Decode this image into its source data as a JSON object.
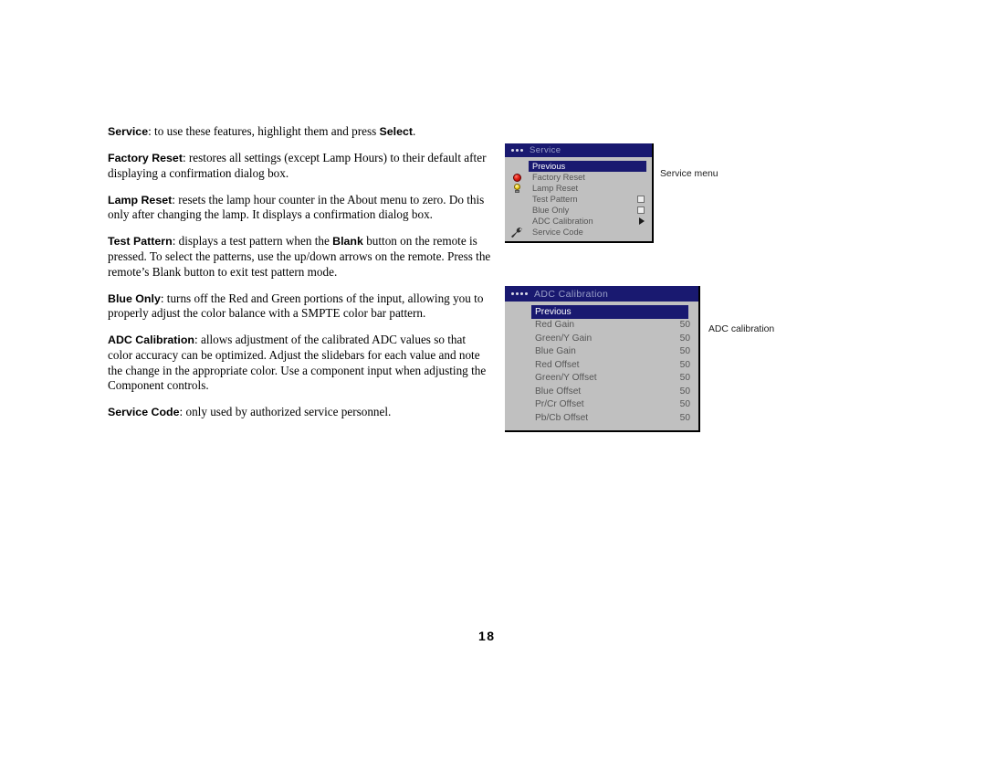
{
  "document": {
    "page_number": "18"
  },
  "body": {
    "paragraphs": [
      {
        "lead": "Service",
        "text_1": ": to use these features, highlight them and press ",
        "inline_bold": "Select",
        "text_2": "."
      },
      {
        "lead": "Factory Reset",
        "text_1": ": restores all settings (except Lamp Hours) to their default after displaying a confirmation dialog box.",
        "inline_bold": "",
        "text_2": ""
      },
      {
        "lead": "Lamp Reset",
        "text_1": ": resets the lamp hour counter in the About menu to zero. Do this only after changing the lamp. It displays a confirmation dialog box.",
        "inline_bold": "",
        "text_2": ""
      },
      {
        "lead": "Test Pattern",
        "text_1": ": displays a test pattern when the ",
        "inline_bold": "Blank",
        "text_2": " button on the remote is pressed. To select the patterns, use the up/down arrows on the remote. Press the remote’s Blank button to exit test pattern mode."
      },
      {
        "lead": "Blue Only",
        "text_1": ": turns off the Red and Green portions of the input, allowing you to properly adjust the color balance with a SMPTE color bar pattern.",
        "inline_bold": "",
        "text_2": ""
      },
      {
        "lead": "ADC Calibration",
        "text_1": ": allows adjustment of the calibrated ADC values so that color accuracy can be optimized. Adjust the slidebars for each value and note the change in the appropriate color. Use a component input when adjusting the Component controls.",
        "inline_bold": "",
        "text_2": ""
      },
      {
        "lead": "Service Code",
        "text_1": ": only used by authorized service personnel.",
        "inline_bold": "",
        "text_2": ""
      }
    ]
  },
  "service_menu": {
    "title": "Service",
    "title_dots": 3,
    "caption": "Service menu",
    "colors": {
      "title_bar": "#191970",
      "highlight": "#191970",
      "body": "#c0c0c0",
      "text": "#565656"
    },
    "items": [
      {
        "label": "Previous",
        "icon": "",
        "widget": "none",
        "selected": true
      },
      {
        "label": "Factory Reset",
        "icon": "reset-icon",
        "widget": "none",
        "selected": false
      },
      {
        "label": "Lamp Reset",
        "icon": "lamp-icon",
        "widget": "none",
        "selected": false
      },
      {
        "label": "Test Pattern",
        "icon": "",
        "widget": "checkbox",
        "selected": false
      },
      {
        "label": "Blue Only",
        "icon": "",
        "widget": "checkbox",
        "selected": false
      },
      {
        "label": "ADC Calibration",
        "icon": "",
        "widget": "arrow",
        "selected": false
      },
      {
        "label": "Service Code",
        "icon": "wrench-icon",
        "widget": "none",
        "selected": false
      }
    ]
  },
  "adc_menu": {
    "title": "ADC Calibration",
    "title_dots": 4,
    "caption": "ADC calibration",
    "colors": {
      "title_bar": "#191970",
      "highlight": "#191970",
      "body": "#c0c0c0",
      "text": "#565656"
    },
    "items": [
      {
        "label": "Previous",
        "value": "",
        "selected": true
      },
      {
        "label": "Red Gain",
        "value": "50",
        "selected": false
      },
      {
        "label": "Green/Y Gain",
        "value": "50",
        "selected": false
      },
      {
        "label": "Blue Gain",
        "value": "50",
        "selected": false
      },
      {
        "label": "Red Offset",
        "value": "50",
        "selected": false
      },
      {
        "label": "Green/Y Offset",
        "value": "50",
        "selected": false
      },
      {
        "label": "Blue Offset",
        "value": "50",
        "selected": false
      },
      {
        "label": "Pr/Cr Offset",
        "value": "50",
        "selected": false
      },
      {
        "label": "Pb/Cb Offset",
        "value": "50",
        "selected": false
      }
    ]
  }
}
